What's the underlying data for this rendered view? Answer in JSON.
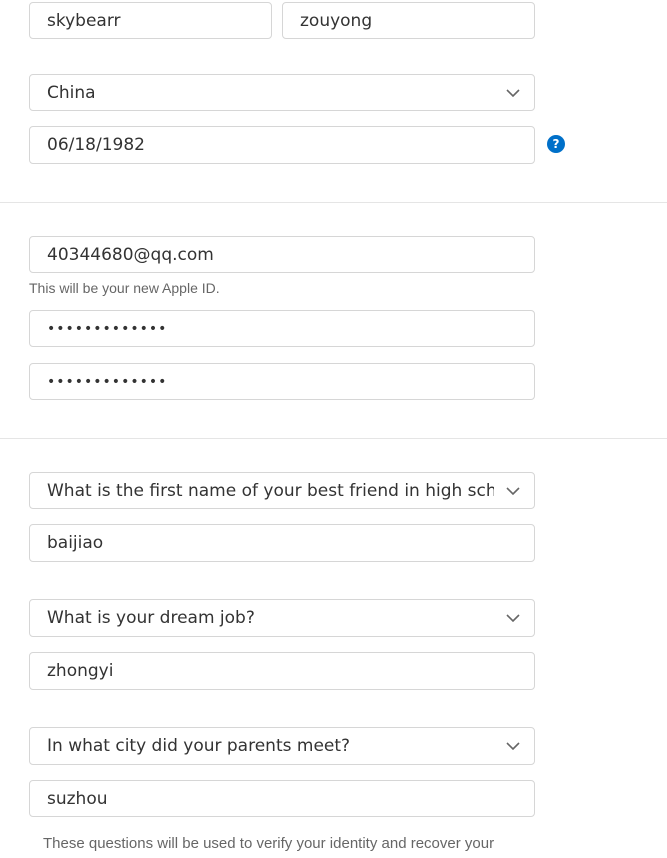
{
  "name": {
    "first": "skybearr",
    "last": "zouyong"
  },
  "country": {
    "selected": "China"
  },
  "birthday": {
    "value": "06/18/1982",
    "help_glyph": "?"
  },
  "account": {
    "email": "40344680@qq.com",
    "email_hint": "This will be your new Apple ID.",
    "password_mask": "•••••••••••••",
    "confirm_password_mask": "•••••••••••••"
  },
  "security": {
    "question1": "What is the first name of your best friend in high school?",
    "answer1": "baijiao",
    "question2": "What is your dream job?",
    "answer2": "zhongyi",
    "question3": "In what city did your parents meet?",
    "answer3": "suzhou",
    "footer_note": "These questions will be used to verify your identity and recover your"
  },
  "colors": {
    "accent": "#0070c9",
    "border": "#d6d6d6",
    "text": "#333333",
    "hint": "#666666"
  },
  "icons": {
    "dropdown": "chevron-down-icon",
    "help": "help-icon"
  }
}
